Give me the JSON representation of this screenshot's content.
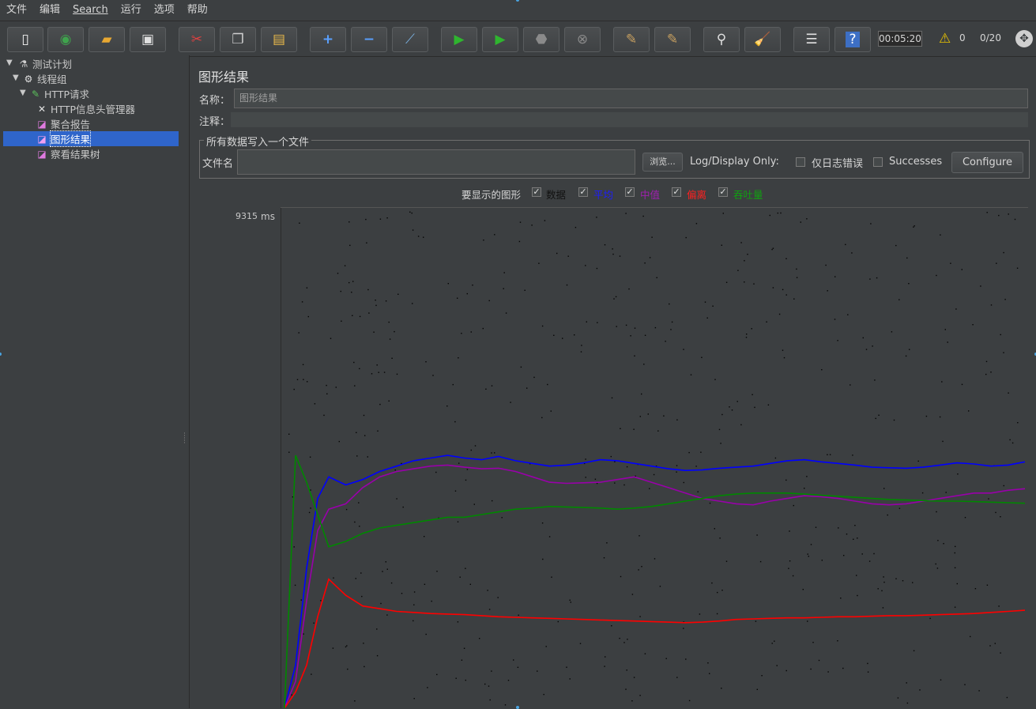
{
  "menu": [
    "文件",
    "编辑",
    "Search",
    "运行",
    "选项",
    "帮助"
  ],
  "toolbar": {
    "buttons": [
      "new-icon",
      "templates-icon",
      "open-icon",
      "save-icon",
      "cut-icon",
      "copy-icon",
      "paste-icon",
      "expand-icon",
      "collapse-icon",
      "toggle-icon",
      "start-icon",
      "start-no-pause-icon",
      "stop-icon",
      "shutdown-icon",
      "clear-icon",
      "clear-all-icon",
      "search-icon",
      "reset-search-icon",
      "function-helper-icon",
      "help-icon"
    ],
    "timer": "00:05:20",
    "warnings": "0",
    "threads": "0/20"
  },
  "tree": {
    "items": [
      {
        "label": "测试计划",
        "icon": "flask-icon",
        "level": 0
      },
      {
        "label": "线程组",
        "icon": "gear-icon",
        "level": 1
      },
      {
        "label": "HTTP请求",
        "icon": "pipette-icon",
        "level": 2
      },
      {
        "label": "HTTP信息头管理器",
        "icon": "wrench-icon",
        "level": 3
      },
      {
        "label": "聚合报告",
        "icon": "graph-icon",
        "level": 3
      },
      {
        "label": "图形结果",
        "icon": "graph-icon",
        "level": 3,
        "selected": true
      },
      {
        "label": "察看结果树",
        "icon": "graph-icon",
        "level": 3
      }
    ]
  },
  "panel": {
    "title": "图形结果",
    "name_label": "名称：",
    "name_value": "图形结果",
    "comment_label": "注释：",
    "comment_value": "",
    "file_section": "所有数据写入一个文件",
    "file_label": "文件名",
    "file_value": "",
    "browse": "浏览...",
    "log_display": "Log/Display Only:",
    "errors_only": "仅日志错误",
    "successes": "Successes",
    "configure": "Configure",
    "graphs_to_display": "要显示的图形",
    "options": [
      {
        "label": "数据",
        "color": "#000000",
        "checked": true
      },
      {
        "label": "平均",
        "color": "#0000ff",
        "checked": true
      },
      {
        "label": "中值",
        "color": "#9900aa",
        "checked": true
      },
      {
        "label": "偏离",
        "color": "#ff0000",
        "checked": true
      },
      {
        "label": "吞吐量",
        "color": "#008800",
        "checked": true
      }
    ],
    "y_max": "9315",
    "y_unit": "ms"
  },
  "chart_data": {
    "type": "line",
    "ylim": [
      0,
      9315
    ],
    "series": [
      {
        "name": "平均",
        "color": "#0000ff",
        "values": [
          0,
          800,
          2600,
          3900,
          4300,
          4150,
          4250,
          4400,
          4500,
          4600,
          4650,
          4700,
          4650,
          4620,
          4680,
          4600,
          4550,
          4500,
          4520,
          4560,
          4620,
          4600,
          4550,
          4500,
          4450,
          4420,
          4430,
          4460,
          4480,
          4500,
          4550,
          4600,
          4620,
          4580,
          4550,
          4520,
          4480,
          4470,
          4460,
          4480,
          4520,
          4560,
          4540,
          4500,
          4520,
          4580
        ]
      },
      {
        "name": "中值",
        "color": "#9900aa",
        "values": [
          0,
          500,
          2000,
          3300,
          3700,
          3800,
          4100,
          4300,
          4400,
          4450,
          4500,
          4520,
          4480,
          4450,
          4460,
          4400,
          4300,
          4200,
          4180,
          4190,
          4200,
          4250,
          4300,
          4200,
          4100,
          4000,
          3900,
          3850,
          3800,
          3780,
          3850,
          3900,
          3950,
          3930,
          3900,
          3850,
          3800,
          3780,
          3800,
          3850,
          3900,
          3950,
          4000,
          4000,
          4050,
          4080
        ]
      },
      {
        "name": "偏离",
        "color": "#ff0000",
        "values": [
          0,
          300,
          800,
          1700,
          2400,
          2100,
          1900,
          1850,
          1800,
          1780,
          1760,
          1750,
          1740,
          1720,
          1700,
          1690,
          1680,
          1670,
          1660,
          1650,
          1640,
          1630,
          1620,
          1610,
          1600,
          1590,
          1600,
          1620,
          1650,
          1660,
          1670,
          1680,
          1680,
          1690,
          1700,
          1700,
          1710,
          1720,
          1720,
          1730,
          1740,
          1750,
          1760,
          1780,
          1800,
          1820
        ]
      },
      {
        "name": "吞吐量",
        "color": "#008800",
        "values": [
          0,
          4700,
          4200,
          3600,
          3000,
          3100,
          3250,
          3350,
          3400,
          3450,
          3500,
          3550,
          3550,
          3600,
          3650,
          3700,
          3720,
          3750,
          3740,
          3730,
          3720,
          3700,
          3720,
          3750,
          3800,
          3850,
          3900,
          3950,
          3980,
          4000,
          4000,
          4000,
          3980,
          3960,
          3940,
          3920,
          3900,
          3880,
          3870,
          3860,
          3850,
          3850,
          3840,
          3830,
          3820,
          3810
        ]
      }
    ]
  }
}
